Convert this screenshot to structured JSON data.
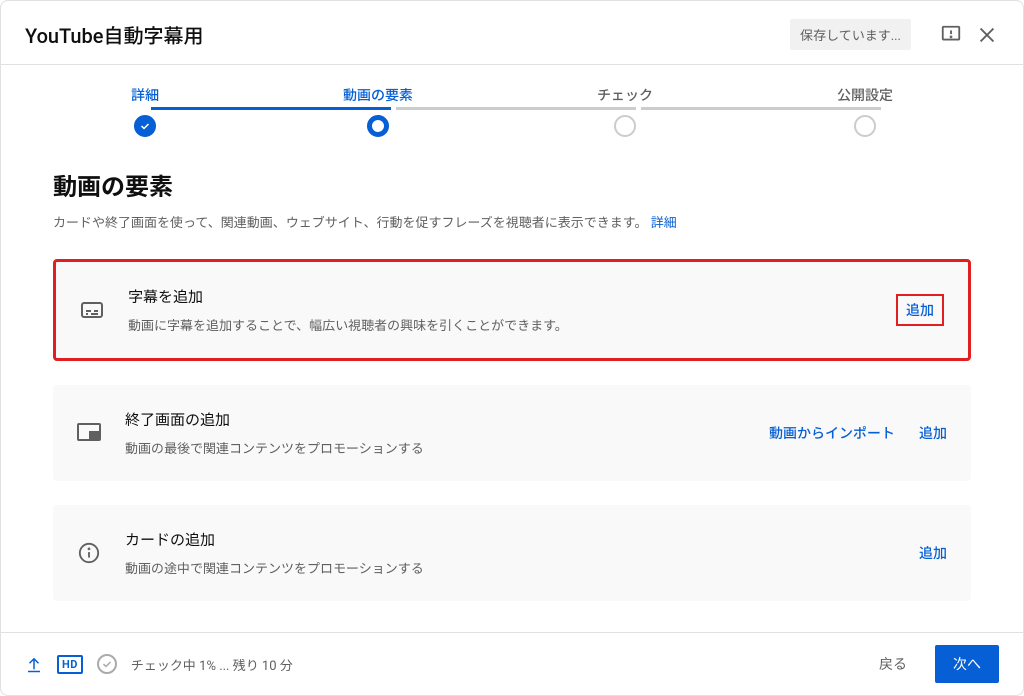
{
  "header": {
    "title": "YouTube自動字幕用",
    "save_status": "保存しています..."
  },
  "stepper": {
    "steps": [
      {
        "label": "詳細"
      },
      {
        "label": "動画の要素"
      },
      {
        "label": "チェック"
      },
      {
        "label": "公開設定"
      }
    ]
  },
  "section": {
    "title": "動画の要素",
    "desc": "カードや終了画面を使って、関連動画、ウェブサイト、行動を促すフレーズを視聴者に表示できます。 ",
    "learn_more": "詳細"
  },
  "cards": {
    "subtitles": {
      "title": "字幕を追加",
      "desc": "動画に字幕を追加することで、幅広い視聴者の興味を引くことができます。",
      "action": "追加"
    },
    "endscreen": {
      "title": "終了画面の追加",
      "desc": "動画の最後で関連コンテンツをプロモーションする",
      "import": "動画からインポート",
      "action": "追加"
    },
    "cards": {
      "title": "カードの追加",
      "desc": "動画の途中で関連コンテンツをプロモーションする",
      "action": "追加"
    }
  },
  "footer": {
    "status": "チェック中 1% ... 残り 10 分",
    "back": "戻る",
    "next": "次へ",
    "hd": "HD"
  }
}
